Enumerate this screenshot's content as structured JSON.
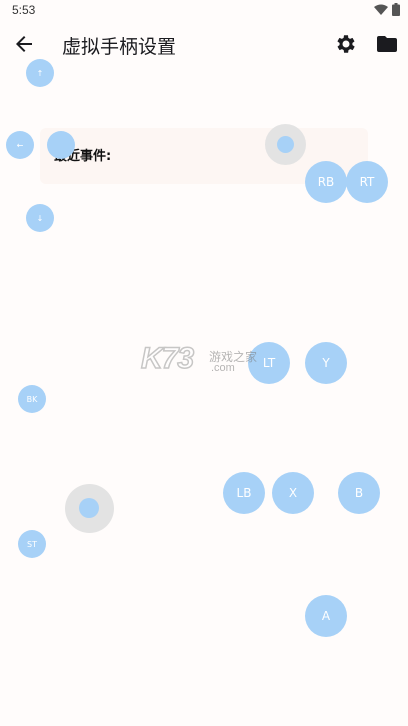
{
  "status_bar": {
    "time": "5:53",
    "icons": [
      "wifi-icon",
      "battery-icon"
    ]
  },
  "app_bar": {
    "title": "虚拟手柄设置",
    "icons": [
      "back-arrow-icon",
      "gear-icon",
      "folder-icon"
    ]
  },
  "events": {
    "label": "最近事件:"
  },
  "dpad": {
    "up": "↑",
    "left": "←",
    "down": "↓"
  },
  "buttons": {
    "rb": "RB",
    "rt": "RT",
    "lt": "LT",
    "y": "Y",
    "lb": "LB",
    "x": "X",
    "b": "B",
    "a": "A",
    "bk": "BK",
    "st": "ST"
  },
  "watermark": {
    "brand": "K73",
    "cn": "游戏之家",
    "domain": ".com"
  },
  "colors": {
    "button": "#a7d1f7",
    "stick_base": "#e3e3e3",
    "background": "#fffcfb"
  }
}
